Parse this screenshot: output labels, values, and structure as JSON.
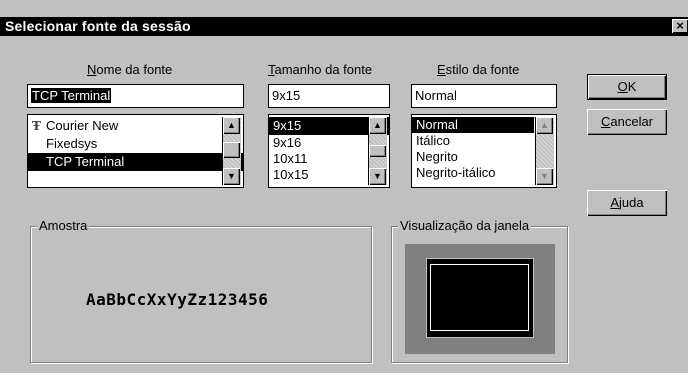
{
  "dialog": {
    "title": "Selecionar fonte da sessão",
    "close_glyph": "×"
  },
  "font_name": {
    "label_accel": "N",
    "label_rest": "ome da fonte",
    "value": "TCP Terminal",
    "items": [
      {
        "label": "Courier New",
        "icon": "truetype-icon",
        "selected": false
      },
      {
        "label": "Fixedsys",
        "icon": "",
        "selected": false
      },
      {
        "label": "TCP Terminal",
        "icon": "",
        "selected": true
      }
    ]
  },
  "font_size": {
    "label_accel": "T",
    "label_rest": "amanho da fonte",
    "value": "9x15",
    "items": [
      {
        "label": "9x15",
        "selected": true
      },
      {
        "label": "9x16",
        "selected": false
      },
      {
        "label": "10x11",
        "selected": false
      },
      {
        "label": "10x15",
        "selected": false
      }
    ]
  },
  "font_style": {
    "label_accel": "E",
    "label_rest": "stilo da fonte",
    "value": "Normal",
    "items": [
      {
        "label": "Normal",
        "selected": true
      },
      {
        "label": "Itálico",
        "selected": false
      },
      {
        "label": "Negrito",
        "selected": false
      },
      {
        "label": "Negrito-itálico",
        "selected": false
      }
    ]
  },
  "buttons": {
    "ok_accel": "O",
    "ok_rest": "K",
    "cancel_accel": "C",
    "cancel_rest": "ancelar",
    "help_accel": "A",
    "help_rest": "juda"
  },
  "sample": {
    "title": "Amostra",
    "text": "AaBbCcXxYyZz123456"
  },
  "window_preview": {
    "title": "Visualização da janela"
  },
  "icons": {
    "scroll_up": "▲",
    "scroll_down": "▼",
    "truetype": "Ŧ"
  }
}
